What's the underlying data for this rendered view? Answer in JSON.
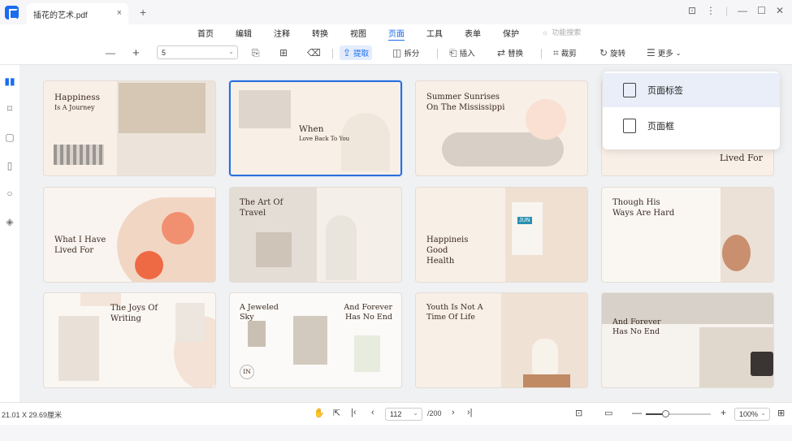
{
  "window": {
    "tab_title": "插花的艺术.pdf",
    "tab_close": "×",
    "new_tab": "+",
    "controls": [
      "⊡",
      "⋮",
      "|",
      "—",
      "☐",
      "✕"
    ]
  },
  "menu": {
    "items": [
      "首页",
      "编辑",
      "注释",
      "转换",
      "视图",
      "页面",
      "工具",
      "表单",
      "保护"
    ],
    "active": "页面",
    "feature_search": "功能搜索"
  },
  "toolbar": {
    "zoom_out": "—",
    "zoom_in": "+",
    "page_select_value": "5",
    "extract": "提取",
    "split": "拆分",
    "insert": "插入",
    "replace": "替换",
    "crop": "裁剪",
    "rotate": "旋转",
    "more": "更多"
  },
  "popup": {
    "items": [
      "页面标签",
      "页面框"
    ]
  },
  "pages": [
    {
      "title": "Happiness",
      "subtitle": "Is A Journey"
    },
    {
      "title": "When",
      "subtitle": "Love Back To You"
    },
    {
      "title": "Summer Sunrises On The Mississippi"
    },
    {
      "title": "Lived For"
    },
    {
      "title": "What I Have Lived For"
    },
    {
      "title": "The Art Of Travel"
    },
    {
      "title": "Happineis Good Health"
    },
    {
      "title": "Though His Ways Are Hard"
    },
    {
      "title": "The Joys Of Writing"
    },
    {
      "title": "A Jeweled Sky",
      "title2": "And Forever Has No End",
      "badge": "IN"
    },
    {
      "title": "Youth Is Not A Time Of Life"
    },
    {
      "title": "And Forever Has No End"
    }
  ],
  "page_labels": {
    "jun": "JUN"
  },
  "status": {
    "page_size": "21.01 X 29.69厘米",
    "current_page": "112",
    "total_pages": "/200",
    "zoom": "100%",
    "zoom_level": 0.3
  },
  "colors": {
    "accent": "#1a6cf0"
  }
}
